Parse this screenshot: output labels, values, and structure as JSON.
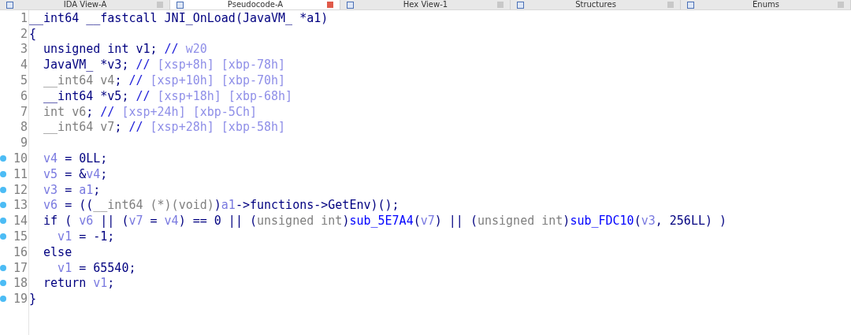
{
  "tabs": [
    {
      "label": "IDA View-A",
      "selected": false
    },
    {
      "label": "Pseudocode-A",
      "selected": true
    },
    {
      "label": "Hex View-1",
      "selected": false
    },
    {
      "label": "Structures",
      "selected": false
    },
    {
      "label": "Enums",
      "selected": false
    }
  ],
  "lines": [
    {
      "number": "1",
      "breakpoint": false,
      "tokens": [
        {
          "kind": "code",
          "text": "__int64 __fastcall JNI_OnLoad(JavaVM_ *a1)"
        }
      ]
    },
    {
      "number": "2",
      "breakpoint": false,
      "tokens": [
        {
          "kind": "code",
          "text": "{"
        }
      ]
    },
    {
      "number": "3",
      "breakpoint": false,
      "tokens": [
        {
          "kind": "code",
          "text": "  unsigned int v1; "
        },
        {
          "kind": "mark",
          "text": "// "
        },
        {
          "kind": "comment",
          "text": "w20"
        }
      ]
    },
    {
      "number": "4",
      "breakpoint": false,
      "tokens": [
        {
          "kind": "code",
          "text": "  JavaVM_ *v3; "
        },
        {
          "kind": "mark",
          "text": "// "
        },
        {
          "kind": "comment",
          "text": "[xsp+8h] [xbp-78h]"
        }
      ]
    },
    {
      "number": "5",
      "breakpoint": false,
      "tokens": [
        {
          "kind": "gray",
          "text": "  __int64 v4"
        },
        {
          "kind": "code",
          "text": "; "
        },
        {
          "kind": "mark",
          "text": "// "
        },
        {
          "kind": "comment",
          "text": "[xsp+10h] [xbp-70h]"
        }
      ]
    },
    {
      "number": "6",
      "breakpoint": false,
      "tokens": [
        {
          "kind": "code",
          "text": "  __int64 *v5; "
        },
        {
          "kind": "mark",
          "text": "// "
        },
        {
          "kind": "comment",
          "text": "[xsp+18h] [xbp-68h]"
        }
      ]
    },
    {
      "number": "7",
      "breakpoint": false,
      "tokens": [
        {
          "kind": "gray",
          "text": "  int v6"
        },
        {
          "kind": "code",
          "text": "; "
        },
        {
          "kind": "mark",
          "text": "// "
        },
        {
          "kind": "comment",
          "text": "[xsp+24h] [xbp-5Ch]"
        }
      ]
    },
    {
      "number": "8",
      "breakpoint": false,
      "tokens": [
        {
          "kind": "gray",
          "text": "  __int64 v7"
        },
        {
          "kind": "code",
          "text": "; "
        },
        {
          "kind": "mark",
          "text": "// "
        },
        {
          "kind": "comment",
          "text": "[xsp+28h] [xbp-58h]"
        }
      ]
    },
    {
      "number": "9",
      "breakpoint": false
    },
    {
      "number": "10",
      "breakpoint": true,
      "tokens": [
        {
          "kind": "var",
          "text": "  v4"
        },
        {
          "kind": "code",
          "text": " = 0LL;"
        }
      ]
    },
    {
      "number": "11",
      "breakpoint": true,
      "tokens": [
        {
          "kind": "var",
          "text": "  v5"
        },
        {
          "kind": "code",
          "text": " = &"
        },
        {
          "kind": "var",
          "text": "v4"
        },
        {
          "kind": "code",
          "text": ";"
        }
      ]
    },
    {
      "number": "12",
      "breakpoint": true,
      "tokens": [
        {
          "kind": "var",
          "text": "  v3"
        },
        {
          "kind": "code",
          "text": " = "
        },
        {
          "kind": "var",
          "text": "a1"
        },
        {
          "kind": "code",
          "text": ";"
        }
      ]
    },
    {
      "number": "13",
      "breakpoint": true,
      "tokens": [
        {
          "kind": "var",
          "text": "  v6"
        },
        {
          "kind": "code",
          "text": " = (("
        },
        {
          "kind": "gray",
          "text": "__int64 (*)(void)"
        },
        {
          "kind": "code",
          "text": ")"
        },
        {
          "kind": "var",
          "text": "a1"
        },
        {
          "kind": "code",
          "text": "->functions->GetEnv)();"
        }
      ]
    },
    {
      "number": "14",
      "breakpoint": true,
      "tokens": [
        {
          "kind": "code",
          "text": "  if ( "
        },
        {
          "kind": "var",
          "text": "v6"
        },
        {
          "kind": "code",
          "text": " || ("
        },
        {
          "kind": "var",
          "text": "v7"
        },
        {
          "kind": "code",
          "text": " = "
        },
        {
          "kind": "var",
          "text": "v4"
        },
        {
          "kind": "code",
          "text": ") == 0 || ("
        },
        {
          "kind": "gray",
          "text": "unsigned int"
        },
        {
          "kind": "code",
          "text": ")"
        },
        {
          "kind": "func",
          "text": "sub_5E7A4"
        },
        {
          "kind": "code",
          "text": "("
        },
        {
          "kind": "var",
          "text": "v7"
        },
        {
          "kind": "code",
          "text": ") || ("
        },
        {
          "kind": "gray",
          "text": "unsigned int"
        },
        {
          "kind": "code",
          "text": ")"
        },
        {
          "kind": "func",
          "text": "sub_FDC10"
        },
        {
          "kind": "code",
          "text": "("
        },
        {
          "kind": "var",
          "text": "v3"
        },
        {
          "kind": "code",
          "text": ", 256LL) )"
        }
      ]
    },
    {
      "number": "15",
      "breakpoint": true,
      "tokens": [
        {
          "kind": "var",
          "text": "    v1"
        },
        {
          "kind": "code",
          "text": " = -1;"
        }
      ]
    },
    {
      "number": "16",
      "breakpoint": false,
      "tokens": [
        {
          "kind": "code",
          "text": "  else"
        }
      ]
    },
    {
      "number": "17",
      "breakpoint": true,
      "tokens": [
        {
          "kind": "var",
          "text": "    v1"
        },
        {
          "kind": "code",
          "text": " = 65540;"
        }
      ]
    },
    {
      "number": "18",
      "breakpoint": true,
      "tokens": [
        {
          "kind": "code",
          "text": "  return "
        },
        {
          "kind": "var",
          "text": "v1"
        },
        {
          "kind": "code",
          "text": ";"
        }
      ]
    },
    {
      "number": "19",
      "breakpoint": true,
      "tokens": [
        {
          "kind": "code",
          "text": "}"
        }
      ]
    }
  ]
}
